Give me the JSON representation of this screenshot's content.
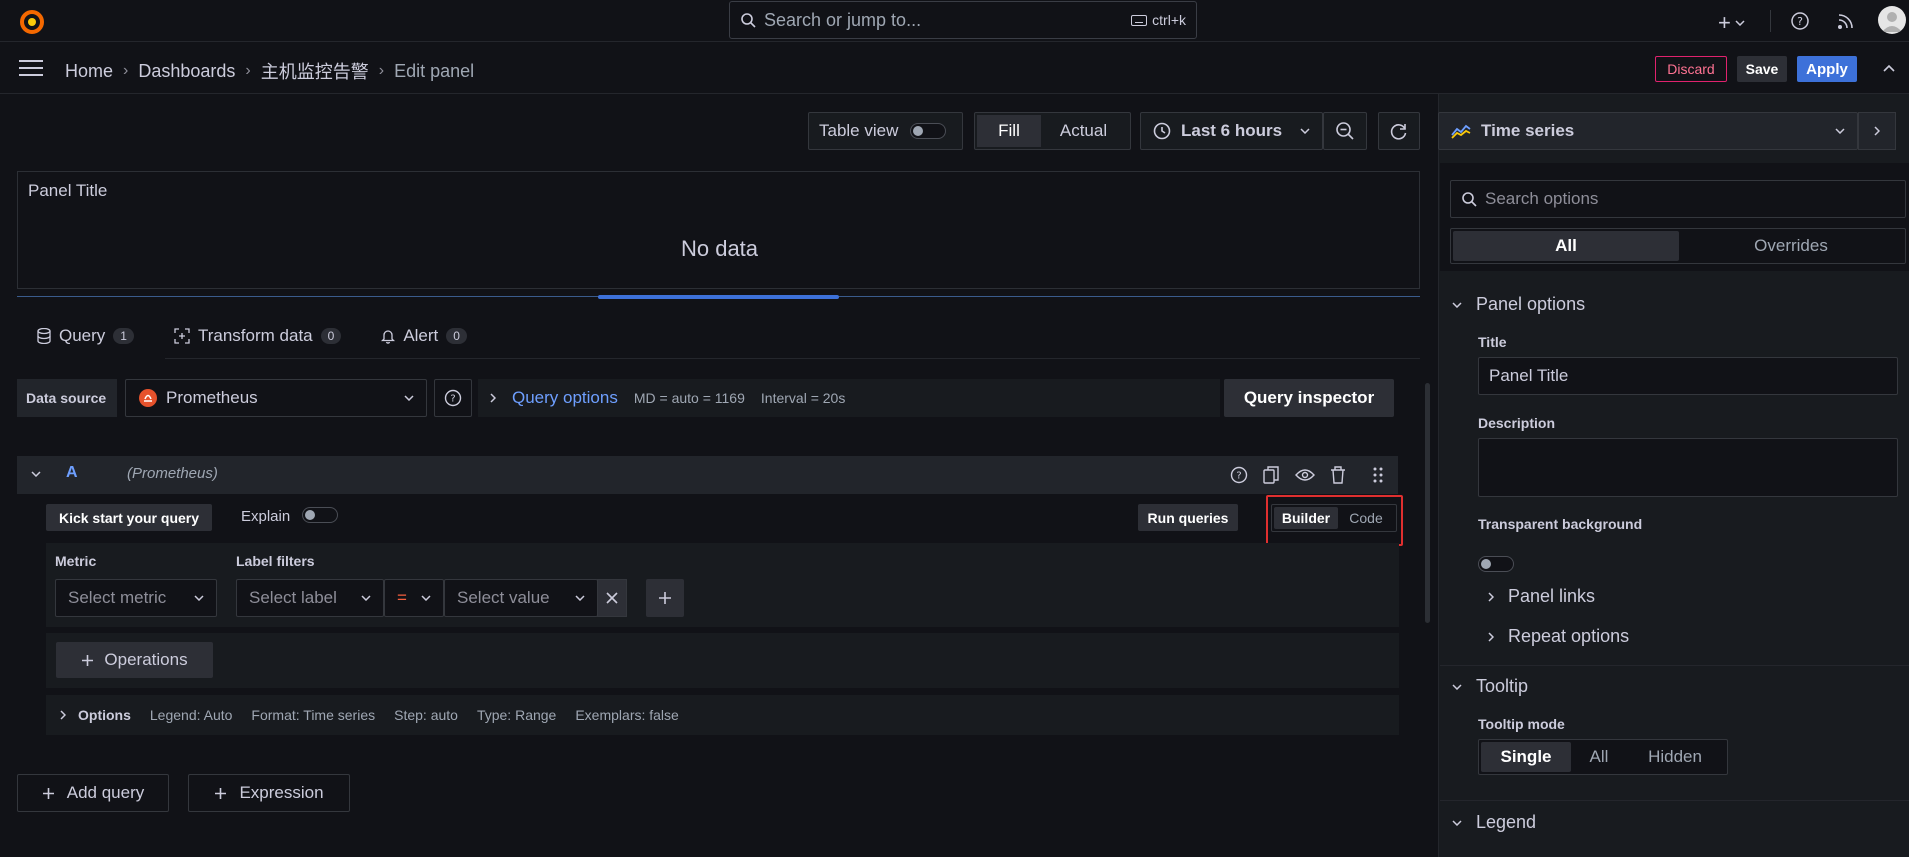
{
  "topbar": {
    "search_placeholder": "Search or jump to...",
    "search_shortcut": "ctrl+k"
  },
  "breadcrumbs": [
    "Home",
    "Dashboards",
    "主机监控告警",
    "Edit panel"
  ],
  "actions": {
    "discard": "Discard",
    "save": "Save",
    "apply": "Apply"
  },
  "toolbar": {
    "table_view": "Table view",
    "fill": "Fill",
    "actual": "Actual",
    "time_range": "Last 6 hours"
  },
  "preview": {
    "title": "Panel Title",
    "empty": "No data"
  },
  "tabs": [
    {
      "label": "Query",
      "count": "1"
    },
    {
      "label": "Transform data",
      "count": "0"
    },
    {
      "label": "Alert",
      "count": "0"
    }
  ],
  "query_header": {
    "datasource_label": "Data source",
    "datasource": "Prometheus",
    "query_options": "Query options",
    "md": "MD = auto = 1169",
    "interval": "Interval = 20s",
    "inspector": "Query inspector"
  },
  "query_row": {
    "ref": "A",
    "ds": "(Prometheus)",
    "kick_start": "Kick start your query",
    "explain": "Explain",
    "run": "Run queries",
    "builder": "Builder",
    "code": "Code",
    "metric_label": "Metric",
    "metric_placeholder": "Select metric",
    "label_filters_label": "Label filters",
    "label_placeholder": "Select label",
    "operator": "=",
    "value_placeholder": "Select value",
    "operations": "Operations",
    "options_label": "Options",
    "options_summary": [
      "Legend: Auto",
      "Format: Time series",
      "Step: auto",
      "Type: Range",
      "Exemplars: false"
    ]
  },
  "bottom_buttons": {
    "add_query": "Add query",
    "expression": "Expression"
  },
  "options_pane": {
    "viz": "Time series",
    "search_placeholder": "Search options",
    "tab_all": "All",
    "tab_overrides": "Overrides",
    "panel_options": "Panel options",
    "title_label": "Title",
    "title_value": "Panel Title",
    "description_label": "Description",
    "transparent_label": "Transparent background",
    "panel_links": "Panel links",
    "repeat_options": "Repeat options",
    "tooltip": "Tooltip",
    "tooltip_mode_label": "Tooltip mode",
    "tooltip_modes": [
      "Single",
      "All",
      "Hidden"
    ],
    "legend": "Legend"
  },
  "colors": {
    "accent_orange": "#f55f3e",
    "link_blue": "#6e9fff",
    "apply_blue": "#3d71d9",
    "highlight_red": "#e02f2f"
  }
}
